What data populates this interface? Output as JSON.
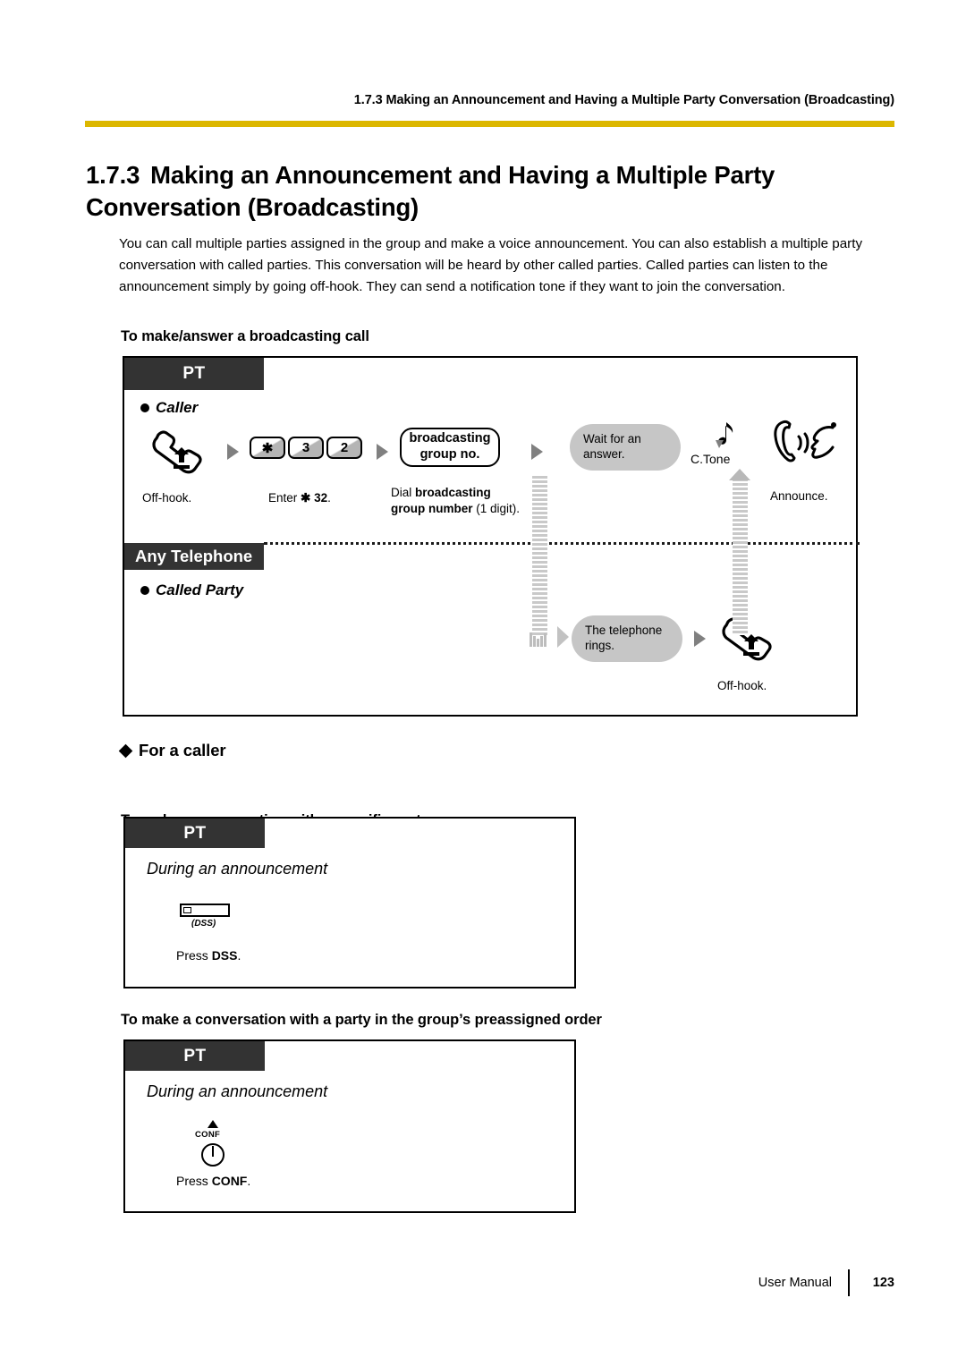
{
  "header": {
    "running_title": "1.7.3 Making an Announcement and Having a Multiple Party Conversation (Broadcasting)",
    "rule_color": "#dcb700"
  },
  "section": {
    "number": "1.7.3",
    "title": "Making an Announcement and Having a Multiple Party Conversation (Broadcasting)",
    "intro": "You can call multiple parties assigned in the group and make a voice announcement. You can also establish a multiple party conversation with called parties. This conversation will be heard by other called parties. Called parties can listen to the announcement simply by going off-hook. They can send a notification tone if they want to join the conversation."
  },
  "main_diagram": {
    "heading": "To make/answer a broadcasting call",
    "pt_tag": "PT",
    "any_telephone_tag": "Any Telephone",
    "caller_label": "Caller",
    "called_party_label": "Called Party",
    "caller_steps": {
      "offhook_caption": "Off-hook.",
      "enter_caption_prefix": "Enter ",
      "enter_caption_code": "✱ 32",
      "enter_caption_suffix": ".",
      "keys": [
        "✱",
        "3",
        "2"
      ],
      "group_box_line1": "broadcasting",
      "group_box_line2": "group no.",
      "dial_caption_prefix": "Dial ",
      "dial_caption_bold1": "broadcasting",
      "dial_caption_bold2": "group number",
      "dial_caption_suffix": " (1 digit).",
      "wait_bubble_line1": "Wait for an",
      "wait_bubble_line2": "answer.",
      "ctone_label": "C.Tone",
      "announce_caption": "Announce."
    },
    "called_steps": {
      "rings_bubble_line1": "The telephone",
      "rings_bubble_line2": "rings.",
      "offhook_caption": "Off-hook."
    }
  },
  "for_caller": {
    "label": "For a caller",
    "specific_party": {
      "heading": "To make a conversation with a specific party",
      "pt_tag": "PT",
      "during": "During an announcement",
      "key_caption": "(DSS)",
      "press_prefix": "Press ",
      "press_key": "DSS",
      "press_suffix": "."
    },
    "preassigned_order": {
      "heading": "To make a conversation with a party in the group’s preassigned order",
      "pt_tag": "PT",
      "during": "During an announcement",
      "key_label": "CONF",
      "press_prefix": "Press ",
      "press_key": "CONF",
      "press_suffix": "."
    }
  },
  "footer": {
    "document_name": "User Manual",
    "page_number": "123"
  }
}
